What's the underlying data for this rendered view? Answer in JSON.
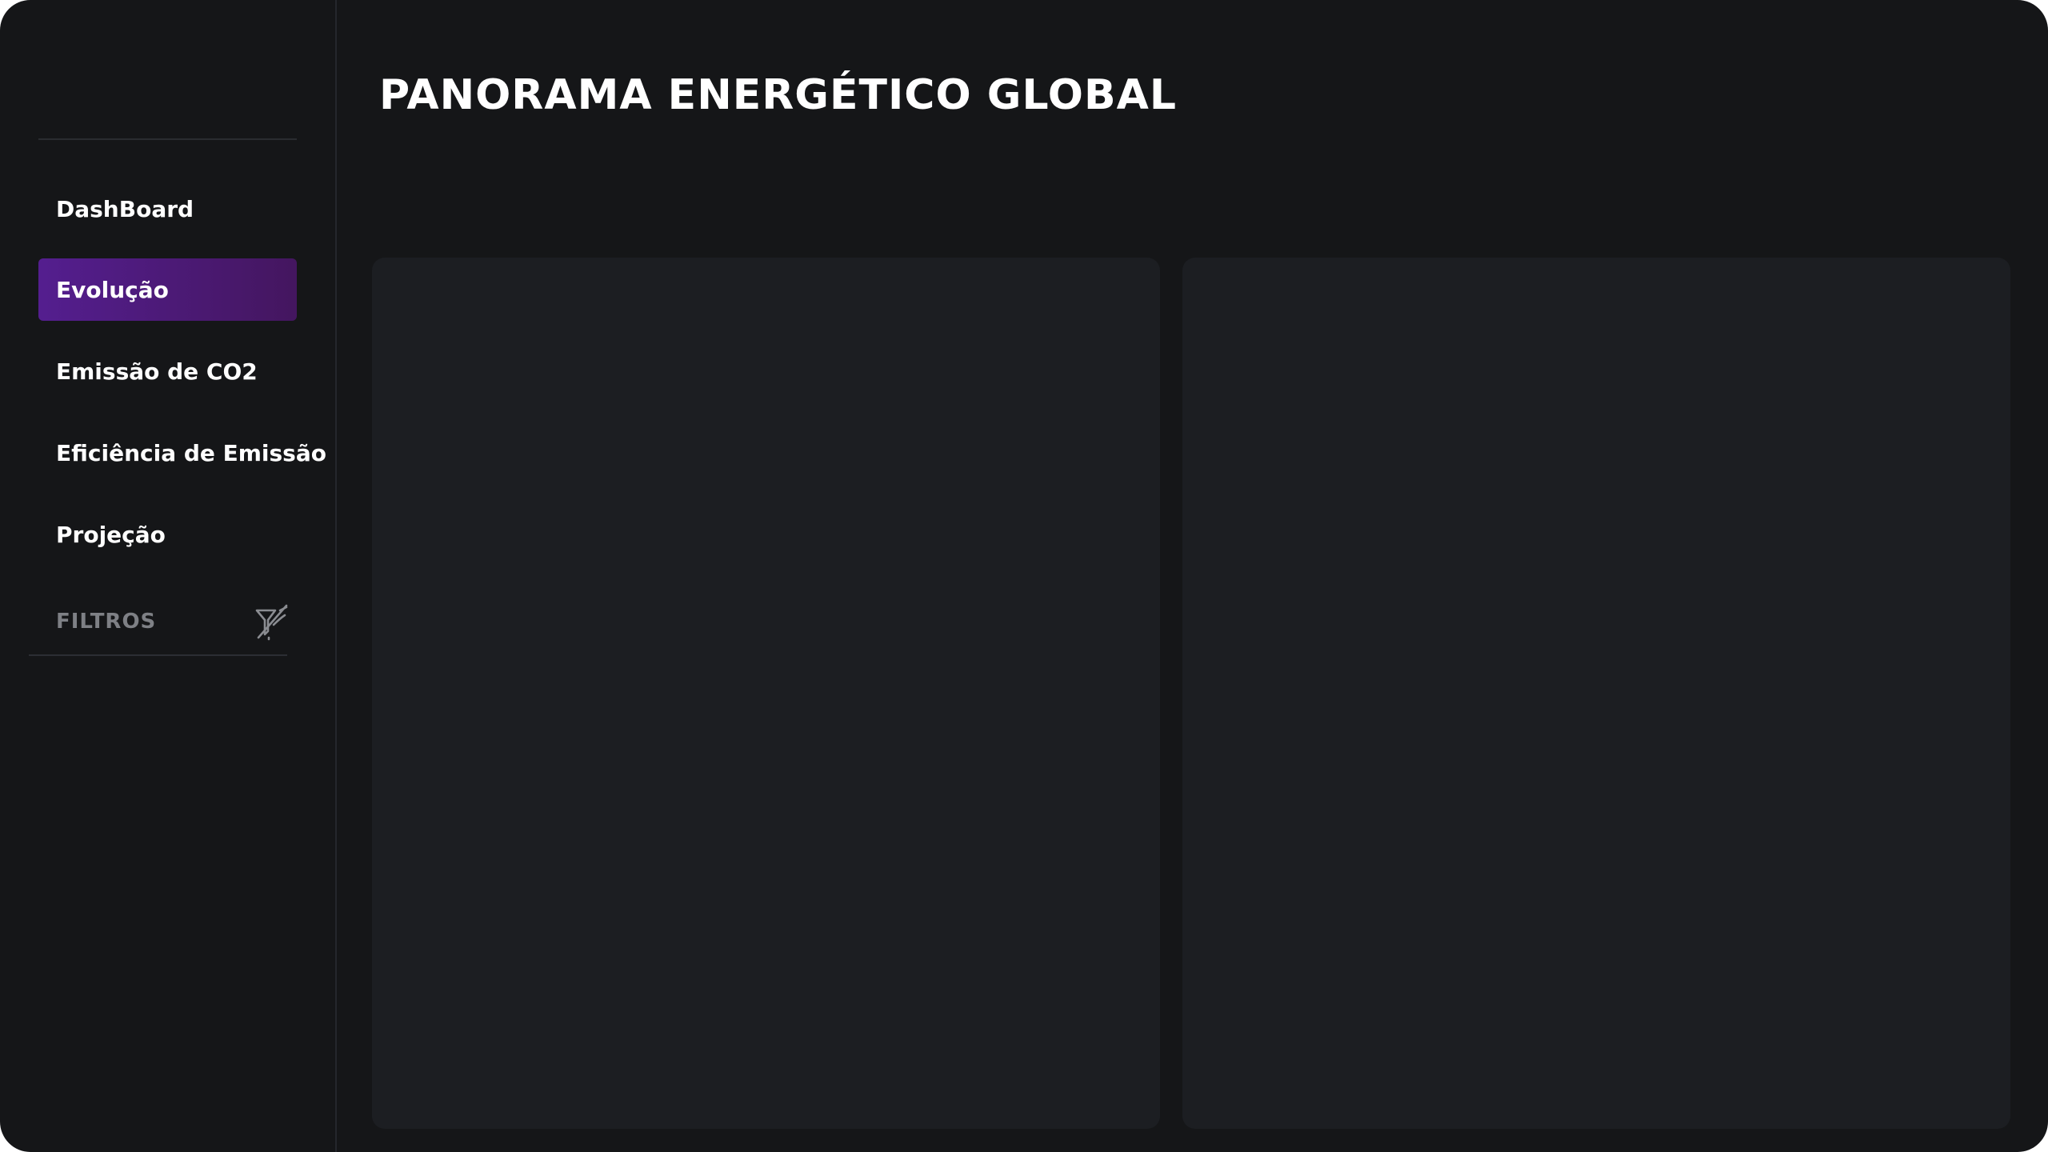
{
  "header": {
    "title": "PANORAMA ENERGÉTICO GLOBAL"
  },
  "sidebar": {
    "items": [
      {
        "label": "DashBoard",
        "active": false
      },
      {
        "label": "Evolução",
        "active": true
      },
      {
        "label": "Emissão de CO2",
        "active": false
      },
      {
        "label": "Eficiência de Emissão",
        "active": false
      },
      {
        "label": "Projeção",
        "active": false
      }
    ],
    "filters": {
      "label": "FILTROS",
      "icon": "filter-off-icon"
    }
  },
  "colors": {
    "background": "#151618",
    "panel": "#1c1e22",
    "accent_active": "#541e8f",
    "text_primary": "#ffffff",
    "text_muted": "#7e8085"
  }
}
